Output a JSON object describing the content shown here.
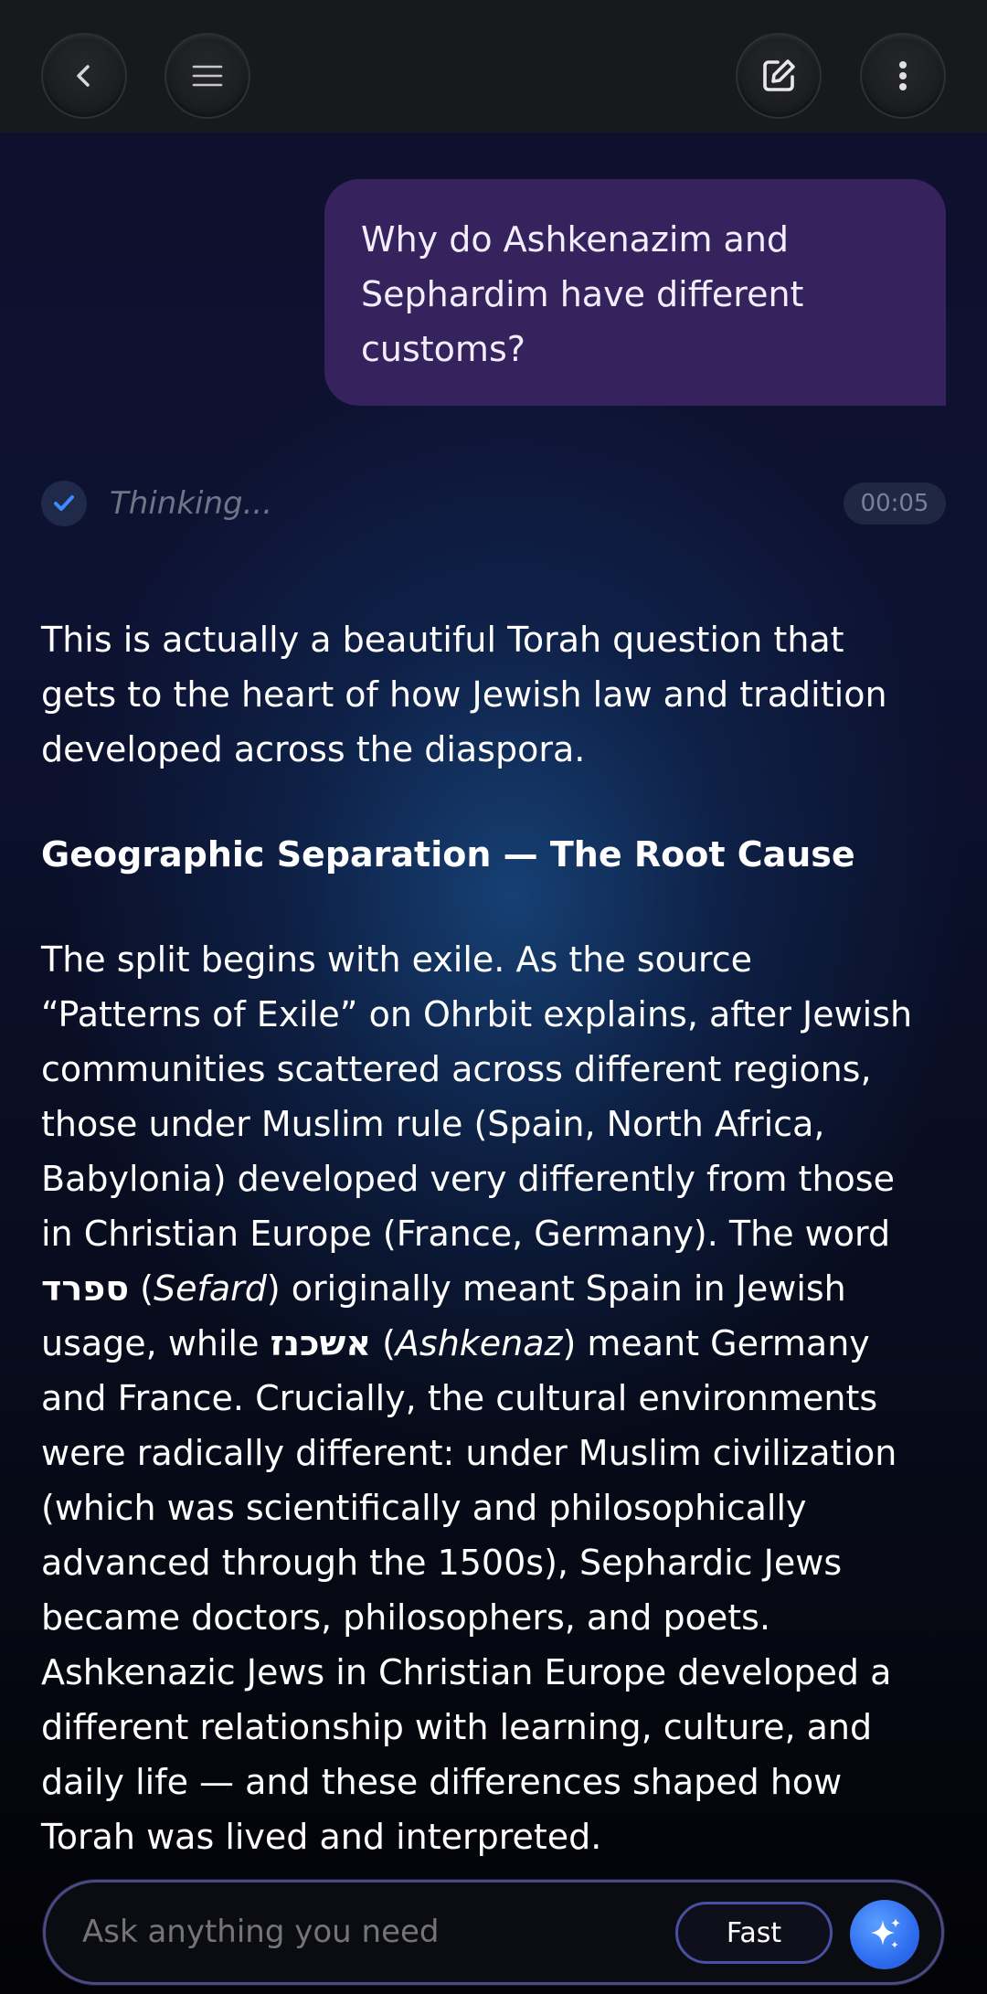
{
  "header": {
    "back_icon": "chevron-left-icon",
    "menu_icon": "hamburger-icon",
    "new_chat_icon": "edit-square-icon",
    "more_icon": "more-vertical-icon"
  },
  "user_message": {
    "text": "Why do Ashkenazim and Sephardim have different customs?"
  },
  "thinking": {
    "label": "Thinking...",
    "elapsed": "00:05",
    "status_icon": "check-icon"
  },
  "answer": {
    "intro": "This is actually a beautiful Torah question that gets to the heart of how Jewish law and tradition developed across the diaspora.",
    "heading": "Geographic Separation — The Root Cause",
    "body_part1": "The split begins with exile. As the source “Patterns of Exile” on Ohrbit explains, after Jewish communities scattered across different regions, those under Muslim rule (Spain, North Africa, Babylonia) developed very differently from those in Christian Europe (France, Germany). The word ",
    "hebrew_sefard": "ספרד",
    "paren_open_1": " (",
    "term_sefard": "Sefard",
    "body_part2": ") originally meant Spain in Jewish usage, while ",
    "hebrew_ashkenaz": "אשכנז",
    "paren_open_2": " (",
    "term_ashkenaz": "Ashkenaz",
    "body_part3": ") meant Germany and France. Crucially, the cultural environments were radically different: under Muslim civilization (which was scientifically and philosophically advanced through the 1500s), Sephardic Jews became doctors, philosophers, and poets. Ashkenazic Jews in Christian Europe developed a different relationship with learning, culture, and daily life — and these differences shaped how Torah was lived and interpreted."
  },
  "composer": {
    "placeholder": "Ask anything you need",
    "mode_label": "Fast",
    "send_icon": "sparkle-icon"
  },
  "colors": {
    "user_bubble": "#36235d",
    "accent_blue": "#2f6df0",
    "topbar": "#17191c"
  }
}
